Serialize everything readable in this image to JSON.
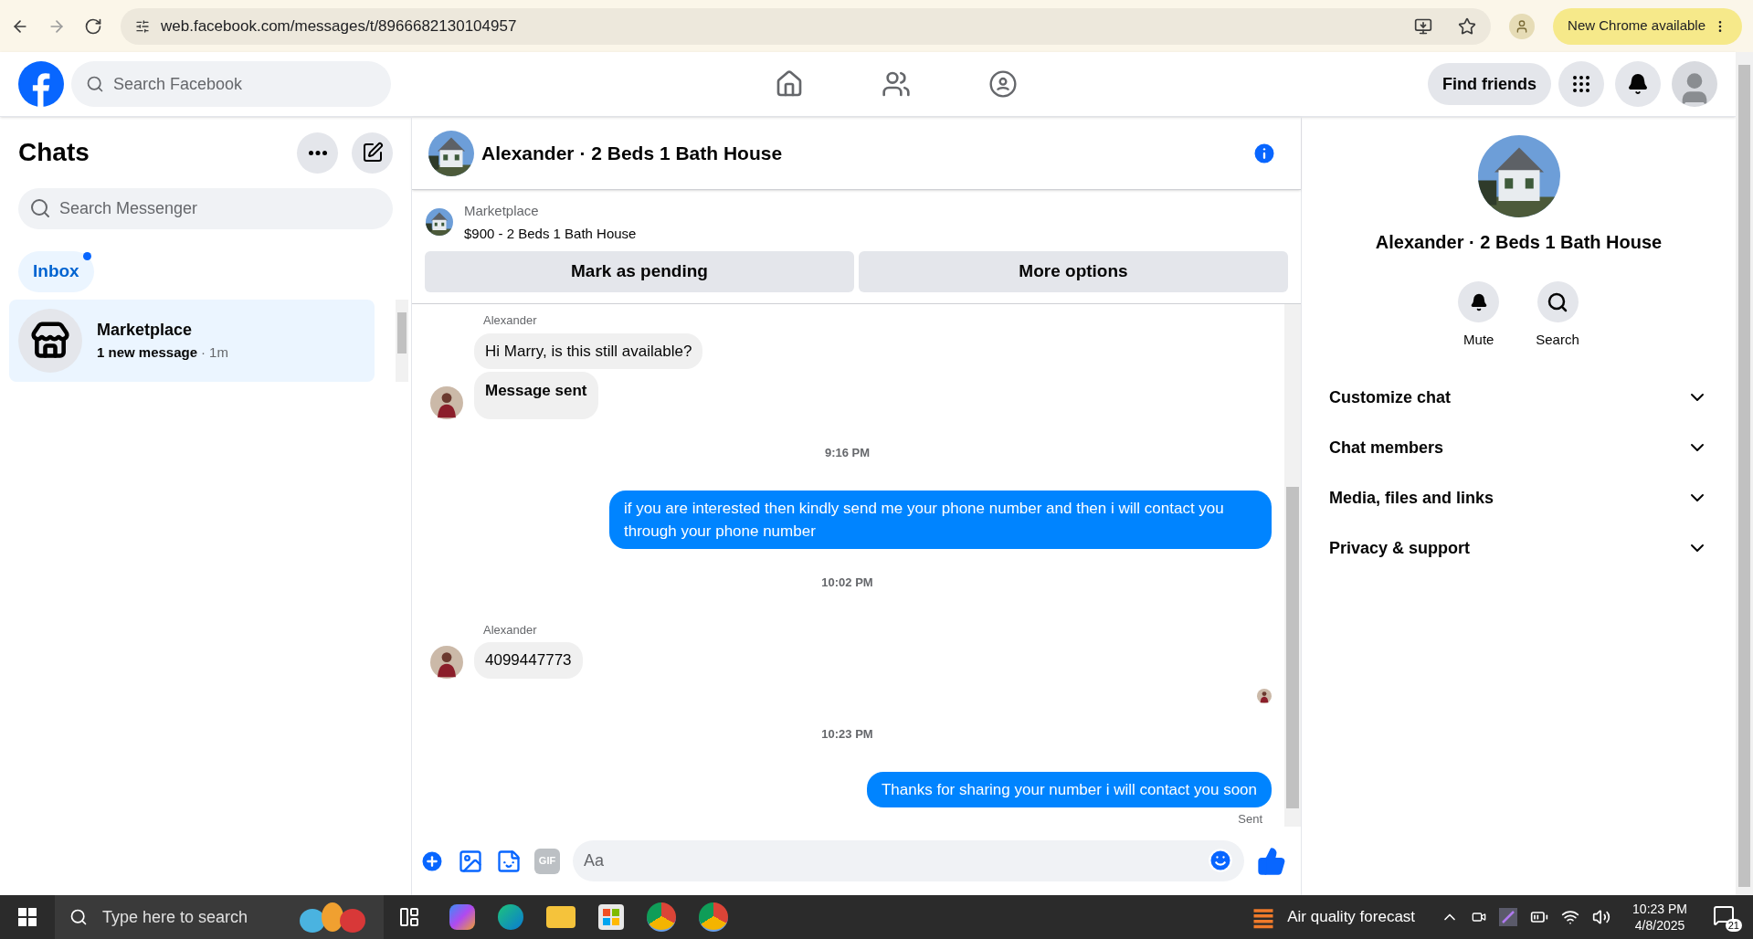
{
  "browser": {
    "url": "web.facebook.com/messages/t/8966682130104957",
    "update_button": "New Chrome available"
  },
  "topbar": {
    "search_placeholder": "Search Facebook",
    "find_friends": "Find friends"
  },
  "chats_panel": {
    "title": "Chats",
    "search_placeholder": "Search Messenger",
    "filters": [
      {
        "label": "Inbox",
        "selected": true,
        "unread": true
      }
    ],
    "conversations": [
      {
        "name": "Marketplace",
        "preview": "1 new message",
        "separator": "·",
        "time": "1m",
        "selected": true,
        "unread": true
      }
    ]
  },
  "conversation": {
    "title": "Alexander · 2 Beds 1 Bath House",
    "listing": {
      "source": "Marketplace",
      "title": "$900 - 2 Beds 1 Bath House",
      "buttons": [
        "Mark as pending",
        "More options"
      ]
    },
    "messages": [
      {
        "kind": "incoming",
        "sender": "Alexander",
        "bubbles": [
          {
            "text": "Hi Marry, is this still available?",
            "bold": false
          },
          {
            "text": "Message sent",
            "bold": true
          }
        ]
      },
      {
        "kind": "timestamp",
        "text": "9:16 PM"
      },
      {
        "kind": "outgoing",
        "bubbles": [
          {
            "text": "if you are interested then kindly send me your phone number and then i will contact you through your phone number",
            "bold": false
          }
        ]
      },
      {
        "kind": "timestamp",
        "text": "10:02 PM"
      },
      {
        "kind": "incoming",
        "sender": "Alexander",
        "bubbles": [
          {
            "text": "4099447773",
            "bold": false
          }
        ]
      },
      {
        "kind": "seen"
      },
      {
        "kind": "timestamp",
        "text": "10:23 PM"
      },
      {
        "kind": "outgoing",
        "bubbles": [
          {
            "text": "Thanks for sharing your number i will contact you soon",
            "bold": false
          }
        ],
        "status": "Sent"
      }
    ],
    "composer_placeholder": "Aa",
    "gif_label": "GIF"
  },
  "details_panel": {
    "name": "Alexander · 2 Beds 1 Bath House",
    "actions": [
      "Mute",
      "Search"
    ],
    "sections": [
      {
        "label": "Customize chat",
        "expanded": false
      },
      {
        "label": "Chat members",
        "expanded": false
      },
      {
        "label": "Media, files and links",
        "expanded": false
      },
      {
        "label": "Privacy & support",
        "expanded": false
      }
    ]
  },
  "taskbar": {
    "search_placeholder": "Type here to search",
    "weather": "Air quality forecast",
    "time": "10:23 PM",
    "date": "4/8/2025",
    "notifications": "21"
  }
}
